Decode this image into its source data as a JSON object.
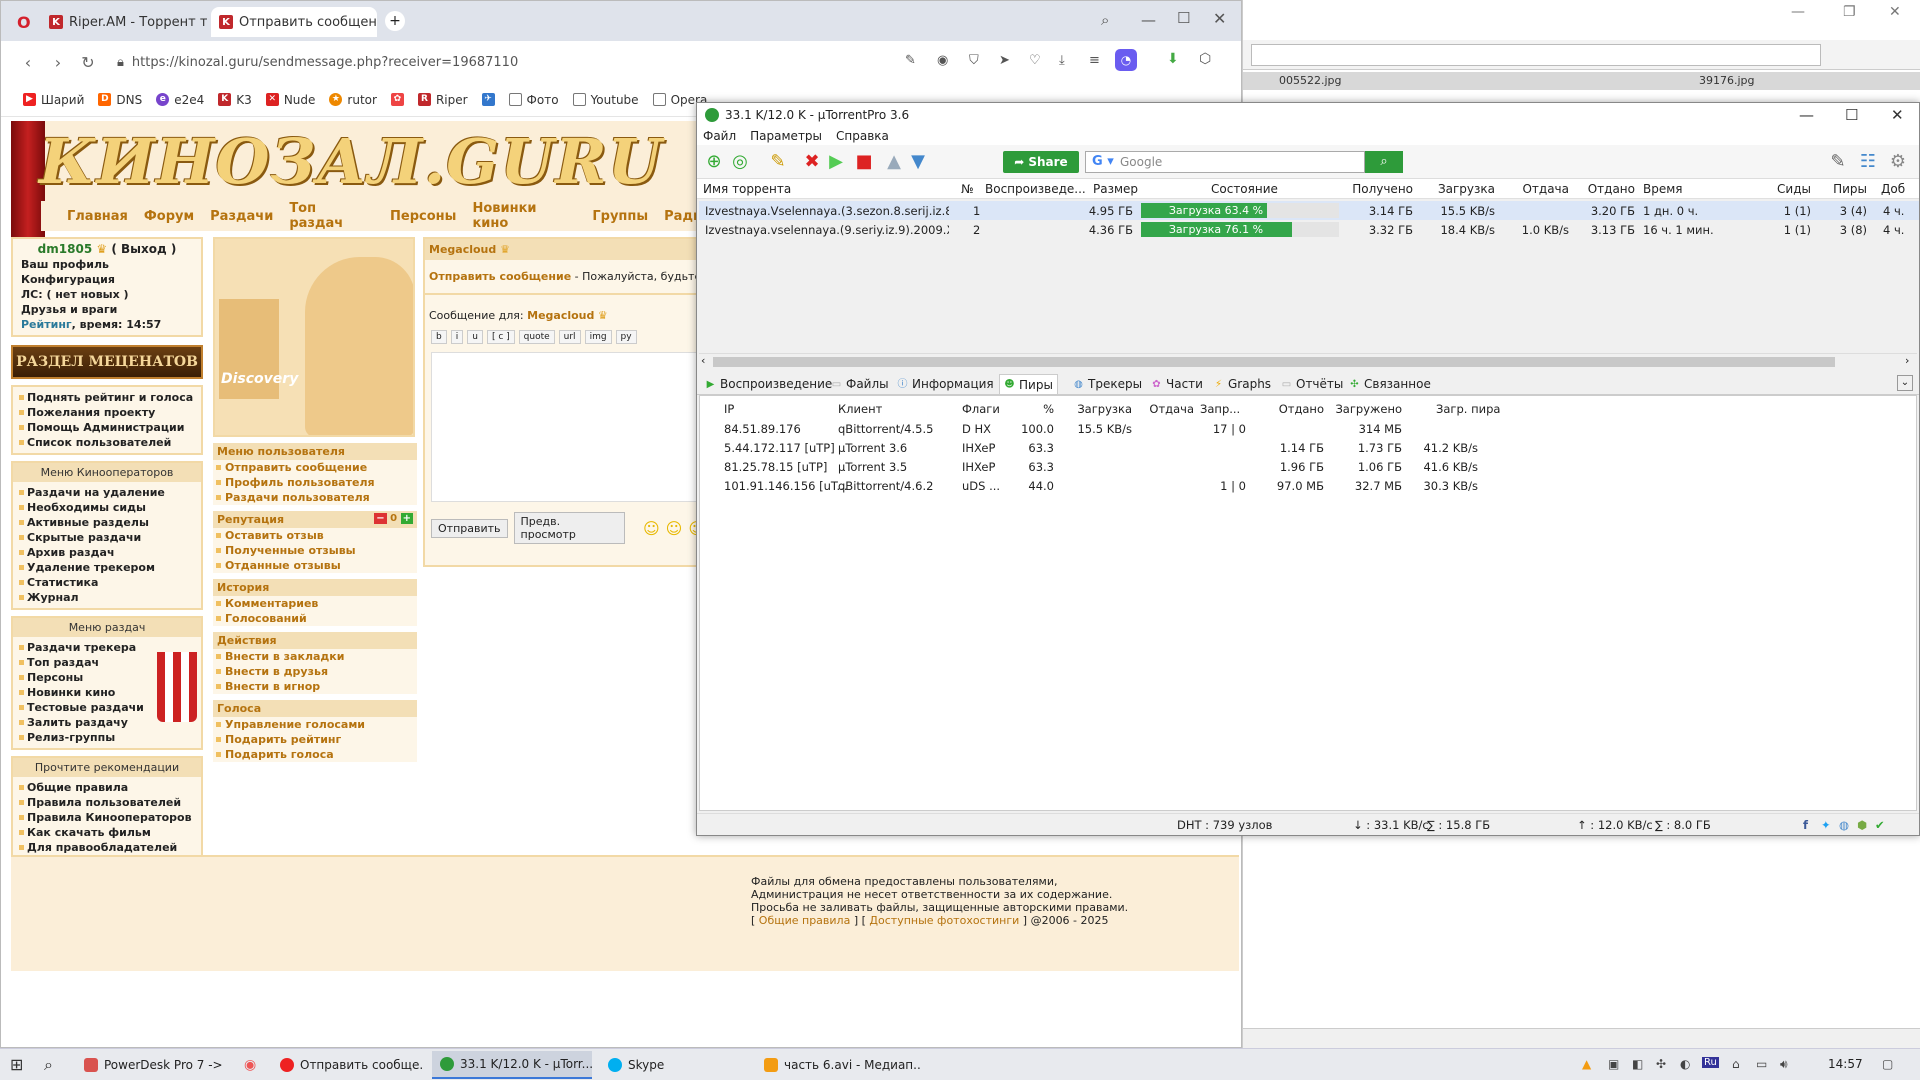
{
  "browser": {
    "tabs": [
      {
        "label": "Riper.AM - Торрент треке",
        "icon": "K"
      },
      {
        "label": "Отправить сообщение :",
        "icon": "K"
      }
    ],
    "new_tab": "+",
    "url": "https://kinozal.guru/sendmessage.php?receiver=19687110",
    "bookmarks": [
      "Шарий",
      "DNS",
      "e2e4",
      "K3",
      "Nude",
      "rutor",
      "Riper",
      "Фото",
      "Youtube",
      "Opera"
    ]
  },
  "site": {
    "logo": "КИНОЗАЛ.GURU",
    "menu": [
      "Главная",
      "Форум",
      "Раздачи",
      "Топ раздач",
      "Персоны",
      "Новинки кино",
      "Группы",
      "Радио"
    ],
    "user": {
      "name": "dm1805",
      "logout": "( Выход )",
      "links": [
        "Ваш профиль",
        "Конфигурация",
        "ЛС: ( нет новых )",
        "Друзья и враги"
      ],
      "rating_label": "Рейтинг",
      "time_label": ", время: 14:57"
    },
    "banner": "РАЗДЕЛ МЕЦЕНАТОВ",
    "patron_links": [
      "Поднять рейтинг и голоса",
      "Пожелания проекту",
      "Помощь Администрации",
      "Список пользователей"
    ],
    "operators_title": "Меню Кинооператоров",
    "operators_links": [
      "Раздачи на удаление",
      "Необходимы сиды",
      "Активные разделы",
      "Скрытые раздачи",
      "Архив раздач",
      "Удаление трекером",
      "Статистика",
      "Журнал"
    ],
    "torrents_title": "Меню раздач",
    "torrents_links": [
      "Раздачи трекера",
      "Топ раздач",
      "Персоны",
      "Новинки кино",
      "Тестовые раздачи",
      "Залить раздачу",
      "Релиз-группы"
    ],
    "rules_title": "Прочтите рекомендации",
    "rules_links": [
      "Общие правила",
      "Правила пользователей",
      "Правила Кинооператоров",
      "Как скачать фильм",
      "Для правообладателей"
    ],
    "portrait_text": "Discovery",
    "user_menu_title": "Меню пользователя",
    "user_menu": [
      "Отправить сообщение",
      "Профиль пользователя",
      "Раздачи пользователя"
    ],
    "reputation_title": "Репутация",
    "reputation_value": "0",
    "reputation_links": [
      "Оставить отзыв",
      "Полученные отзывы",
      "Отданные отзывы"
    ],
    "history_title": "История",
    "history_links": [
      "Комментариев",
      "Голосований"
    ],
    "actions_title": "Действия",
    "actions_links": [
      "Внести в закладки",
      "Внести в друзья",
      "Внести в игнор"
    ],
    "votes_title": "Голоса",
    "votes_links": [
      "Управление голосами",
      "Подарить рейтинг",
      "Подарить голоса"
    ],
    "msg": {
      "receiver_name": "Megacloud",
      "send_title": "Отправить сообщение",
      "send_hint": " - Пожалуйста, будьте пред",
      "for_label": "Сообщение для: ",
      "format_buttons": [
        "b",
        "i",
        "u",
        "[ c ]",
        "quote",
        "url",
        "img",
        "py"
      ],
      "send_button": "Отправить",
      "preview_button": "Предв. просмотр"
    },
    "footer": {
      "line1": "Файлы для обмена предоставлены пользователями,",
      "line2": "Администрация не несет ответственности за их содержание.",
      "line3": "Просьба не заливать файлы, защищенные авторскими правами.",
      "open": "[ ",
      "link1": "Общие правила",
      "mid": " ] [ ",
      "link2": "Доступные фотохостинги",
      "close": " ] @2006 - 2025"
    }
  },
  "bgwin": {
    "file1": "005522.jpg",
    "file2": "39176.jpg"
  },
  "utorrent": {
    "title": "33.1 K/12.0 K - µTorrentPro 3.6",
    "menu": [
      "Файл",
      "Параметры",
      "Справка"
    ],
    "share_label": "Share",
    "search_placeholder": "Google",
    "columns": [
      "Имя торрента",
      "№",
      "Воспроизведе...",
      "Размер",
      "Состояние",
      "Получено",
      "Загрузка",
      "Отдача",
      "Отдано",
      "Время",
      "Сиды",
      "Пиры",
      "Доб"
    ],
    "torrents": [
      {
        "name": "Izvestnaya.Vselennaya.(3.sezon.8.serij.iz.8).2...",
        "num": "1",
        "size": "4.95 ГБ",
        "status": "Загрузка 63.4 %",
        "progress": 63.4,
        "received": "3.14 ГБ",
        "down": "15.5 KB/s",
        "up": "",
        "sent": "3.20 ГБ",
        "time": "1 дн. 0 ч.",
        "seeds": "1 (1)",
        "peers": "3 (4)",
        "added": "4 ч."
      },
      {
        "name": "Izvestnaya.vselennaya.(9.seriy.iz.9).2009.Xvi...",
        "num": "2",
        "size": "4.36 ГБ",
        "status": "Загрузка 76.1 %",
        "progress": 76.1,
        "received": "3.32 ГБ",
        "down": "18.4 KB/s",
        "up": "1.0 KB/s",
        "sent": "3.13 ГБ",
        "time": "16 ч. 1 мин.",
        "seeds": "1 (1)",
        "peers": "3 (8)",
        "added": "4 ч."
      }
    ],
    "detail_tabs": [
      "Воспроизведение",
      "Файлы",
      "Информация",
      "Пиры",
      "Трекеры",
      "Части",
      "Graphs",
      "Отчёты",
      "Связанное"
    ],
    "peer_columns": [
      "IP",
      "Клиент",
      "Флаги",
      "%",
      "Загрузка",
      "Отдача",
      "Запр...",
      "Отдано",
      "Загружено",
      "Загр. пира"
    ],
    "peers": [
      {
        "ip": "84.51.89.176",
        "client": "qBittorrent/4.5.5",
        "flags": "D HX",
        "pct": "100.0",
        "down": "15.5 KB/s",
        "up": "",
        "req": "17 | 0",
        "sent": "",
        "recv": "314 МБ",
        "peer_dl": ""
      },
      {
        "ip": "5.44.172.117 [uTP]",
        "client": "µTorrent 3.6",
        "flags": "IHXeP",
        "pct": "63.3",
        "down": "",
        "up": "",
        "req": "",
        "sent": "1.14 ГБ",
        "recv": "1.73 ГБ",
        "peer_dl": "41.2 KB/s"
      },
      {
        "ip": "81.25.78.15 [uTP]",
        "client": "µTorrent 3.5",
        "flags": "IHXeP",
        "pct": "63.3",
        "down": "",
        "up": "",
        "req": "",
        "sent": "1.96 ГБ",
        "recv": "1.06 ГБ",
        "peer_dl": "41.6 KB/s"
      },
      {
        "ip": "101.91.146.156 [uT...",
        "client": "qBittorrent/4.6.2",
        "flags": "uDS ...",
        "pct": "44.0",
        "down": "",
        "up": "",
        "req": "1 | 0",
        "sent": "97.0 МБ",
        "recv": "32.7 МБ",
        "peer_dl": "30.3 KB/s"
      }
    ],
    "status": {
      "dht": "DHT : 739 узлов",
      "down": "↓ : 33.1 KB/с",
      "down_total": "∑ : 15.8 ГБ",
      "up": "↑ : 12.0 KB/с",
      "up_total": "∑ : 8.0 ГБ"
    }
  },
  "taskbar": {
    "items": [
      "PowerDesk Pro 7 -> ...",
      "Отправить сообще...",
      "33.1 K/12.0 K - µTorr...",
      "Skype",
      "часть 6.avi - Медиап..."
    ],
    "clock": "14:57"
  }
}
